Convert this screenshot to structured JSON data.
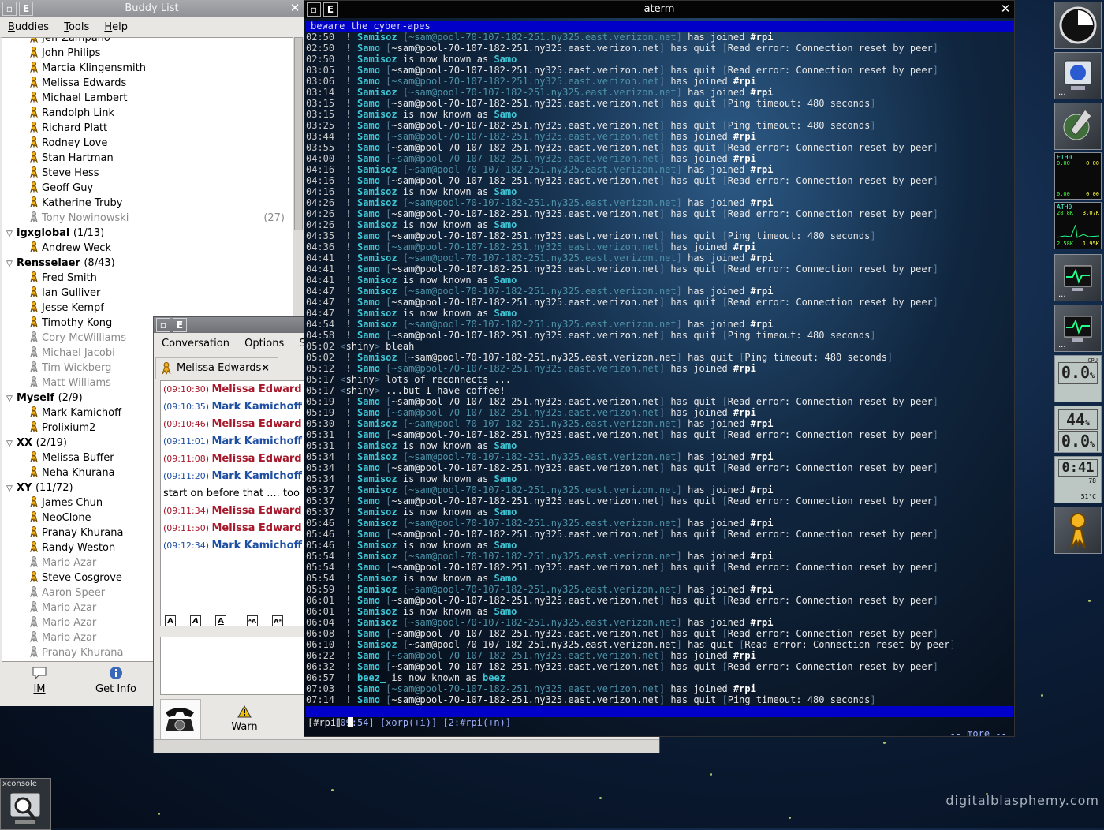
{
  "buddy_window": {
    "title": "Buddy List",
    "menu": [
      "Buddies",
      "Tools",
      "Help"
    ],
    "menu_underline": [
      "B",
      "T",
      "H"
    ],
    "rows": [
      {
        "type": "buddy",
        "name": "Jeff Zampano",
        "state": "online"
      },
      {
        "type": "buddy",
        "name": "John Philips",
        "state": "online"
      },
      {
        "type": "buddy",
        "name": "Marcia Klingensmith",
        "state": "online"
      },
      {
        "type": "buddy",
        "name": "Melissa Edwards",
        "state": "online"
      },
      {
        "type": "buddy",
        "name": "Michael Lambert",
        "state": "online"
      },
      {
        "type": "buddy",
        "name": "Randolph Link",
        "state": "online"
      },
      {
        "type": "buddy",
        "name": "Richard Platt",
        "state": "online"
      },
      {
        "type": "buddy",
        "name": "Rodney Love",
        "state": "online"
      },
      {
        "type": "buddy",
        "name": "Stan Hartman",
        "state": "online"
      },
      {
        "type": "buddy",
        "name": "Steve Hess",
        "state": "online"
      },
      {
        "type": "buddy",
        "name": "Geoff Guy",
        "state": "online"
      },
      {
        "type": "buddy",
        "name": "Katherine Truby",
        "state": "online"
      },
      {
        "type": "buddy",
        "name": "Tony Nowinowski",
        "state": "idle",
        "idle": "(27)"
      },
      {
        "type": "group",
        "name": "igxglobal",
        "count": "(1/13)"
      },
      {
        "type": "buddy",
        "name": "Andrew Weck",
        "state": "online"
      },
      {
        "type": "group",
        "name": "Rensselaer",
        "count": "(8/43)"
      },
      {
        "type": "buddy",
        "name": "Fred Smith",
        "state": "online"
      },
      {
        "type": "buddy",
        "name": "Ian Gulliver",
        "state": "online"
      },
      {
        "type": "buddy",
        "name": "Jesse Kempf",
        "state": "online"
      },
      {
        "type": "buddy",
        "name": "Timothy Kong",
        "state": "online"
      },
      {
        "type": "buddy",
        "name": "Cory McWilliams",
        "state": "idle"
      },
      {
        "type": "buddy",
        "name": "Michael Jacobi",
        "state": "idle"
      },
      {
        "type": "buddy",
        "name": "Tim Wickberg",
        "state": "idle"
      },
      {
        "type": "buddy",
        "name": "Matt Williams",
        "state": "idle"
      },
      {
        "type": "group",
        "name": "Myself",
        "count": "(2/9)"
      },
      {
        "type": "buddy",
        "name": "Mark Kamichoff",
        "state": "online"
      },
      {
        "type": "buddy",
        "name": "Prolixium2",
        "state": "online"
      },
      {
        "type": "group",
        "name": "XX",
        "count": "(2/19)"
      },
      {
        "type": "buddy",
        "name": "Melissa Buffer",
        "state": "online"
      },
      {
        "type": "buddy",
        "name": "Neha Khurana",
        "state": "online"
      },
      {
        "type": "group",
        "name": "XY",
        "count": "(11/72)"
      },
      {
        "type": "buddy",
        "name": "James Chun",
        "state": "online"
      },
      {
        "type": "buddy",
        "name": "NeoClone",
        "state": "online"
      },
      {
        "type": "buddy",
        "name": "Pranay Khurana",
        "state": "online"
      },
      {
        "type": "buddy",
        "name": "Randy Weston",
        "state": "online"
      },
      {
        "type": "buddy",
        "name": "Mario Azar",
        "state": "idle"
      },
      {
        "type": "buddy",
        "name": "Steve Cosgrove",
        "state": "online"
      },
      {
        "type": "buddy",
        "name": "Aaron Speer",
        "state": "idle"
      },
      {
        "type": "buddy",
        "name": "Mario Azar",
        "state": "idle"
      },
      {
        "type": "buddy",
        "name": "Mario Azar",
        "state": "idle"
      },
      {
        "type": "buddy",
        "name": "Mario Azar",
        "state": "idle"
      },
      {
        "type": "buddy",
        "name": "Pranay Khurana",
        "state": "idle"
      }
    ],
    "im_label": "IM",
    "info_label": "Get Info"
  },
  "conv_window": {
    "menu": [
      "Conversation",
      "Options",
      "Se"
    ],
    "tab_label": "Melissa Edwards",
    "messages": [
      {
        "ts": "(09:10:30)",
        "who": "Melissa Edward",
        "side": "them"
      },
      {
        "ts": "(09:10:35)",
        "who": "Mark Kamichoff",
        "side": "me"
      },
      {
        "ts": "(09:10:46)",
        "who": "Melissa Edward",
        "side": "them"
      },
      {
        "ts": "(09:11:01)",
        "who": "Mark Kamichoff",
        "side": "me"
      },
      {
        "ts": "(09:11:08)",
        "who": "Melissa Edward",
        "side": "them"
      },
      {
        "ts": "(09:11:20)",
        "who": "Mark Kamichoff",
        "side": "me"
      },
      {
        "ts": "",
        "who": "",
        "side": "plain",
        "text": "start on before that .... too"
      },
      {
        "ts": "(09:11:34)",
        "who": "Melissa Edward",
        "side": "them"
      },
      {
        "ts": "(09:11:50)",
        "who": "Melissa Edward",
        "side": "them"
      },
      {
        "ts": "(09:12:34)",
        "who": "Mark Kamichoff",
        "side": "me"
      }
    ],
    "warn_label": "Warn"
  },
  "aterm": {
    "title": "aterm",
    "topic": "beware the cyber-apes",
    "lines": [
      [
        "02:50",
        "j",
        "Samisoz",
        "~sam@pool-70-107-182-251.ny325.east.verizon.net",
        "has joined",
        "#rpi"
      ],
      [
        "02:50",
        "q",
        "Samo",
        "~sam@pool-70-107-182-251.ny325.east.verizon.net",
        "has quit",
        "Read error: Connection reset by peer"
      ],
      [
        "02:50",
        "n",
        "Samisoz",
        "Samo"
      ],
      [
        "03:05",
        "q",
        "Samo",
        "~sam@pool-70-107-182-251.ny325.east.verizon.net",
        "has quit",
        "Read error: Connection reset by peer"
      ],
      [
        "03:06",
        "j",
        "Samo",
        "~sam@pool-70-107-182-251.ny325.east.verizon.net",
        "has joined",
        "#rpi"
      ],
      [
        "03:14",
        "j",
        "Samisoz",
        "~sam@pool-70-107-182-251.ny325.east.verizon.net",
        "has joined",
        "#rpi"
      ],
      [
        "03:15",
        "q",
        "Samo",
        "~sam@pool-70-107-182-251.ny325.east.verizon.net",
        "has quit",
        "Ping timeout: 480 seconds"
      ],
      [
        "03:15",
        "n",
        "Samisoz",
        "Samo"
      ],
      [
        "03:25",
        "q",
        "Samo",
        "~sam@pool-70-107-182-251.ny325.east.verizon.net",
        "has quit",
        "Ping timeout: 480 seconds"
      ],
      [
        "03:44",
        "j",
        "Samo",
        "~sam@pool-70-107-182-251.ny325.east.verizon.net",
        "has joined",
        "#rpi"
      ],
      [
        "03:55",
        "q",
        "Samo",
        "~sam@pool-70-107-182-251.ny325.east.verizon.net",
        "has quit",
        "Read error: Connection reset by peer"
      ],
      [
        "04:00",
        "j",
        "Samo",
        "~sam@pool-70-107-182-251.ny325.east.verizon.net",
        "has joined",
        "#rpi"
      ],
      [
        "04:16",
        "j",
        "Samisoz",
        "~sam@pool-70-107-182-251.ny325.east.verizon.net",
        "has joined",
        "#rpi"
      ],
      [
        "04:16",
        "q",
        "Samo",
        "~sam@pool-70-107-182-251.ny325.east.verizon.net",
        "has quit",
        "Read error: Connection reset by peer"
      ],
      [
        "04:16",
        "n",
        "Samisoz",
        "Samo"
      ],
      [
        "04:26",
        "j",
        "Samisoz",
        "~sam@pool-70-107-182-251.ny325.east.verizon.net",
        "has joined",
        "#rpi"
      ],
      [
        "04:26",
        "q",
        "Samo",
        "~sam@pool-70-107-182-251.ny325.east.verizon.net",
        "has quit",
        "Read error: Connection reset by peer"
      ],
      [
        "04:26",
        "n",
        "Samisoz",
        "Samo"
      ],
      [
        "04:35",
        "q",
        "Samo",
        "~sam@pool-70-107-182-251.ny325.east.verizon.net",
        "has quit",
        "Ping timeout: 480 seconds"
      ],
      [
        "04:36",
        "j",
        "Samo",
        "~sam@pool-70-107-182-251.ny325.east.verizon.net",
        "has joined",
        "#rpi"
      ],
      [
        "04:41",
        "j",
        "Samisoz",
        "~sam@pool-70-107-182-251.ny325.east.verizon.net",
        "has joined",
        "#rpi"
      ],
      [
        "04:41",
        "q",
        "Samo",
        "~sam@pool-70-107-182-251.ny325.east.verizon.net",
        "has quit",
        "Read error: Connection reset by peer"
      ],
      [
        "04:41",
        "n",
        "Samisoz",
        "Samo"
      ],
      [
        "04:47",
        "j",
        "Samisoz",
        "~sam@pool-70-107-182-251.ny325.east.verizon.net",
        "has joined",
        "#rpi"
      ],
      [
        "04:47",
        "q",
        "Samo",
        "~sam@pool-70-107-182-251.ny325.east.verizon.net",
        "has quit",
        "Read error: Connection reset by peer"
      ],
      [
        "04:47",
        "n",
        "Samisoz",
        "Samo"
      ],
      [
        "04:54",
        "j",
        "Samisoz",
        "~sam@pool-70-107-182-251.ny325.east.verizon.net",
        "has joined",
        "#rpi"
      ],
      [
        "04:58",
        "q",
        "Samo",
        "~sam@pool-70-107-182-251.ny325.east.verizon.net",
        "has quit",
        "Ping timeout: 480 seconds"
      ],
      [
        "05:02",
        "m",
        "shiny",
        "bleah"
      ],
      [
        "05:02",
        "q",
        "Samisoz",
        "~sam@pool-70-107-182-251.ny325.east.verizon.net",
        "has quit",
        "Ping timeout: 480 seconds"
      ],
      [
        "05:12",
        "j",
        "Samo",
        "~sam@pool-70-107-182-251.ny325.east.verizon.net",
        "has joined",
        "#rpi"
      ],
      [
        "05:17",
        "m",
        "shiny",
        "lots of reconnects ..."
      ],
      [
        "05:17",
        "m",
        "shiny",
        "...but I have coffee!"
      ],
      [
        "05:19",
        "q",
        "Samo",
        "~sam@pool-70-107-182-251.ny325.east.verizon.net",
        "has quit",
        "Read error: Connection reset by peer"
      ],
      [
        "05:19",
        "j",
        "Samo",
        "~sam@pool-70-107-182-251.ny325.east.verizon.net",
        "has joined",
        "#rpi"
      ],
      [
        "05:30",
        "j",
        "Samisoz",
        "~sam@pool-70-107-182-251.ny325.east.verizon.net",
        "has joined",
        "#rpi"
      ],
      [
        "05:31",
        "q",
        "Samo",
        "~sam@pool-70-107-182-251.ny325.east.verizon.net",
        "has quit",
        "Read error: Connection reset by peer"
      ],
      [
        "05:31",
        "n",
        "Samisoz",
        "Samo"
      ],
      [
        "05:34",
        "j",
        "Samisoz",
        "~sam@pool-70-107-182-251.ny325.east.verizon.net",
        "has joined",
        "#rpi"
      ],
      [
        "05:34",
        "q",
        "Samo",
        "~sam@pool-70-107-182-251.ny325.east.verizon.net",
        "has quit",
        "Read error: Connection reset by peer"
      ],
      [
        "05:34",
        "n",
        "Samisoz",
        "Samo"
      ],
      [
        "05:37",
        "j",
        "Samisoz",
        "~sam@pool-70-107-182-251.ny325.east.verizon.net",
        "has joined",
        "#rpi"
      ],
      [
        "05:37",
        "q",
        "Samo",
        "~sam@pool-70-107-182-251.ny325.east.verizon.net",
        "has quit",
        "Read error: Connection reset by peer"
      ],
      [
        "05:37",
        "n",
        "Samisoz",
        "Samo"
      ],
      [
        "05:46",
        "j",
        "Samisoz",
        "~sam@pool-70-107-182-251.ny325.east.verizon.net",
        "has joined",
        "#rpi"
      ],
      [
        "05:46",
        "q",
        "Samo",
        "~sam@pool-70-107-182-251.ny325.east.verizon.net",
        "has quit",
        "Read error: Connection reset by peer"
      ],
      [
        "05:46",
        "n",
        "Samisoz",
        "Samo"
      ],
      [
        "05:54",
        "j",
        "Samisoz",
        "~sam@pool-70-107-182-251.ny325.east.verizon.net",
        "has joined",
        "#rpi"
      ],
      [
        "05:54",
        "q",
        "Samo",
        "~sam@pool-70-107-182-251.ny325.east.verizon.net",
        "has quit",
        "Read error: Connection reset by peer"
      ],
      [
        "05:54",
        "n",
        "Samisoz",
        "Samo"
      ],
      [
        "05:59",
        "j",
        "Samisoz",
        "~sam@pool-70-107-182-251.ny325.east.verizon.net",
        "has joined",
        "#rpi"
      ],
      [
        "06:01",
        "q",
        "Samo",
        "~sam@pool-70-107-182-251.ny325.east.verizon.net",
        "has quit",
        "Read error: Connection reset by peer"
      ],
      [
        "06:01",
        "n",
        "Samisoz",
        "Samo"
      ],
      [
        "06:04",
        "j",
        "Samisoz",
        "~sam@pool-70-107-182-251.ny325.east.verizon.net",
        "has joined",
        "#rpi"
      ],
      [
        "06:08",
        "q",
        "Samo",
        "~sam@pool-70-107-182-251.ny325.east.verizon.net",
        "has quit",
        "Read error: Connection reset by peer"
      ],
      [
        "06:10",
        "q",
        "Samisoz",
        "~sam@pool-70-107-182-251.ny325.east.verizon.net",
        "has quit",
        "Read error: Connection reset by peer"
      ],
      [
        "06:22",
        "j",
        "Samo",
        "~sam@pool-70-107-182-251.ny325.east.verizon.net",
        "has joined",
        "#rpi"
      ],
      [
        "06:32",
        "q",
        "Samo",
        "~sam@pool-70-107-182-251.ny325.east.verizon.net",
        "has quit",
        "Read error: Connection reset by peer"
      ],
      [
        "06:57",
        "n",
        "beez_",
        "beez"
      ],
      [
        "07:03",
        "j",
        "Samo",
        "~sam@pool-70-107-182-251.ny325.east.verizon.net",
        "has joined",
        "#rpi"
      ],
      [
        "07:14",
        "q",
        "Samo",
        "~sam@pool-70-107-182-251.ny325.east.verizon.net",
        "has quit",
        "Ping timeout: 480 seconds"
      ]
    ],
    "known_as": "is now known as",
    "status_left": " [09:54] [xorp(+i)] [2:#rpi(+n)]",
    "status_right": "-- more -- ",
    "prompt": "[#rpi] "
  },
  "dock": {
    "net_if_top": "ETH0",
    "net_top_rx": "0.00",
    "net_top_tx": "0.00",
    "net_bottom_rx": "0.00",
    "net_bottom_tx": "0.00",
    "net2_if": "ATH0",
    "net2_top_rx": "28.8K",
    "net2_top_tx": "3.07K",
    "net2_bottom_rx": "2.58K",
    "net2_bottom_tx": "1.95K",
    "cpu_label": "CPU",
    "cpu_value": "0.0",
    "mem_value": "44",
    "swap_value": "0.0",
    "clock": "0:41",
    "battery_pct": "78",
    "temp": "51°C"
  },
  "xconsole_title": "xconsole",
  "watermark": "digitalblasphemy.com"
}
